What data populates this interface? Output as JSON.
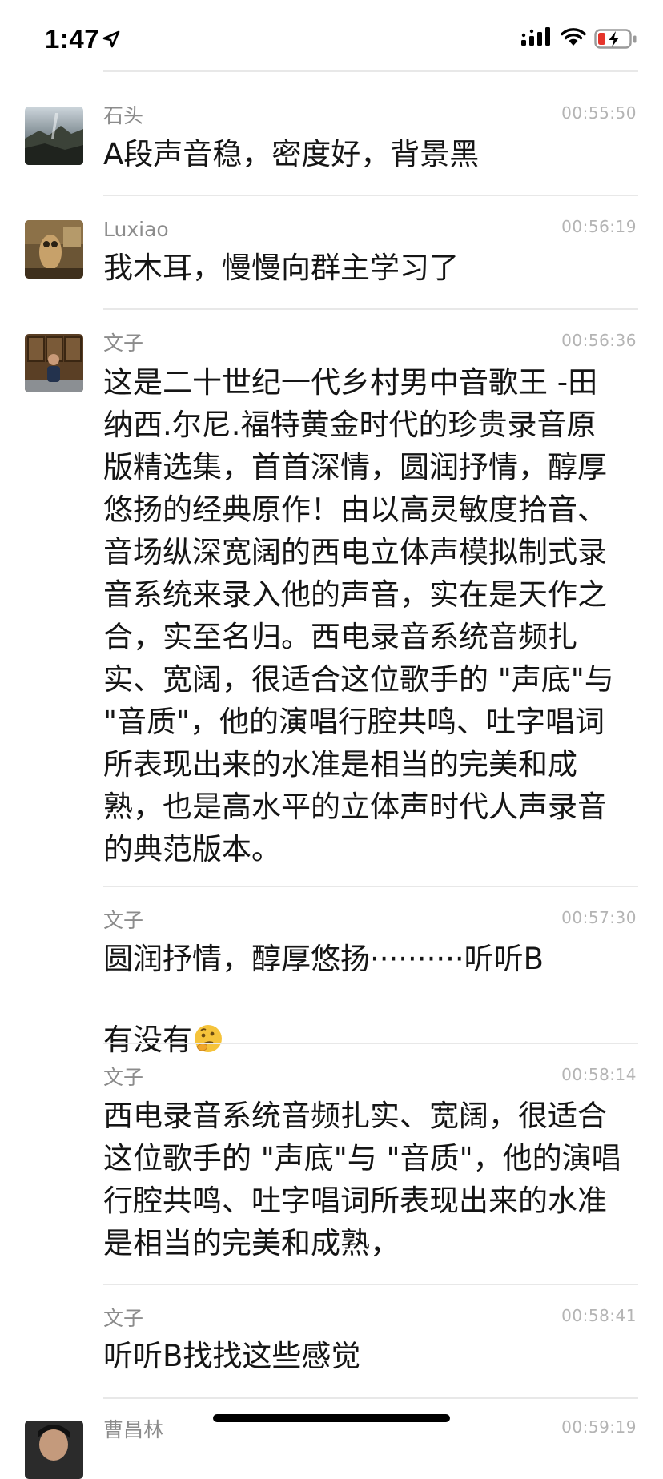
{
  "status_bar": {
    "time": "1:47"
  },
  "messages": [
    {
      "sender": "石头",
      "time": "00:55:50",
      "text": "A段声音稳，密度好，背景黑",
      "avatar": "landscape-photo"
    },
    {
      "sender": "Luxiao",
      "time": "00:56:19",
      "text": "我木耳，慢慢向群主学习了",
      "avatar": "owl-statue-photo"
    },
    {
      "sender": "文子",
      "time": "00:56:36",
      "text": "这是二十世纪一代乡村男中音歌王 -田\n纳西.尔尼.福特黄金时代的珍贵录音原\n版精选集，首首深情，圆润抒情，醇厚\n悠扬的经典原作！由以高灵敏度拾音、\n音场纵深宽阔的西电立体声模拟制式录\n音系统来录入他的声音，实在是天作之\n合，实至名归。西电录音系统音频扎\n实、宽阔，很适合这位歌手的 \"声底\"与\n\"音质\"，他的演唱行腔共鸣、吐字唱词\n所表现出来的水准是相当的完美和成\n熟，也是高水平的立体声时代人声录音\n的典范版本。",
      "avatar": "man-seated-photo"
    },
    {
      "sender": "文子",
      "time": "00:57:30",
      "text": "圆润抒情，醇厚悠扬··········听听B\n有没有",
      "emoji": "thinking-face"
    },
    {
      "sender": "文子",
      "time": "00:58:14",
      "text": "西电录音系统音频扎实、宽阔，很适合\n这位歌手的 \"声底\"与 \"音质\"，他的演唱\n行腔共鸣、吐字唱词所表现出来的水准\n是相当的完美和成熟，"
    },
    {
      "sender": "文子",
      "time": "00:58:41",
      "text": "听听B找找这些感觉"
    },
    {
      "sender": "曹昌林",
      "time": "00:59:19",
      "avatar": "portrait-photo"
    }
  ]
}
